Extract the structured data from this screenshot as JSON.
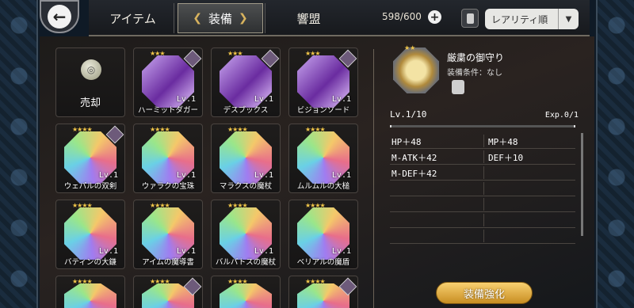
{
  "header": {
    "back_icon": "back-arrow-icon",
    "tabs": [
      {
        "label": "アイテム"
      },
      {
        "label": "装備"
      },
      {
        "label": "響盟"
      }
    ],
    "count": "598/600",
    "sort_label": "レアリティ順"
  },
  "sell": {
    "label": "売却"
  },
  "items": [
    {
      "name": "ハーミットダガー",
      "level": "Lv.1",
      "style": "purple"
    },
    {
      "name": "デスブックス",
      "level": "Lv.1",
      "style": "purple"
    },
    {
      "name": "ビジョンソード",
      "level": "Lv.1",
      "style": "purple"
    },
    {
      "name": "ウェパルの双剣",
      "level": "Lv.1",
      "style": "rainbow"
    },
    {
      "name": "ウァラクの宝珠",
      "level": "Lv.1",
      "style": "rainbow"
    },
    {
      "name": "マラクスの魔杖",
      "level": "Lv.1",
      "style": "rainbow"
    },
    {
      "name": "ムルムルの大槌",
      "level": "Lv.1",
      "style": "rainbow"
    },
    {
      "name": "バティンの大鎌",
      "level": "Lv.1",
      "style": "rainbow"
    },
    {
      "name": "アイムの魔導書",
      "level": "Lv.1",
      "style": "rainbow"
    },
    {
      "name": "バルバトスの魔杖",
      "level": "Lv.1",
      "style": "rainbow"
    },
    {
      "name": "ベリアルの魔盾",
      "level": "Lv.1",
      "style": "rainbow"
    }
  ],
  "detail": {
    "name": "厳粛の御守り",
    "condition": "装備条件：なし",
    "level": "Lv.1/10",
    "exp": "Exp.0/1",
    "stats": [
      [
        "HP＋48",
        "MP＋48"
      ],
      [
        "M-ATK＋42",
        "DEF＋10"
      ],
      [
        "M-DEF＋42",
        ""
      ],
      [
        "",
        ""
      ],
      [
        "",
        ""
      ],
      [
        "",
        ""
      ],
      [
        "",
        ""
      ]
    ],
    "enhance_label": "装備強化"
  }
}
